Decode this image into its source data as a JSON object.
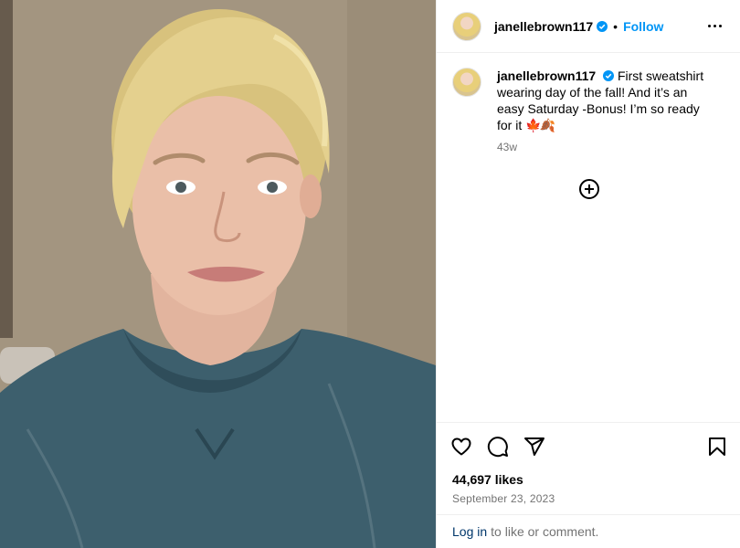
{
  "post": {
    "username": "janellebrown117",
    "follow_label": "Follow",
    "separator": "•",
    "caption_text": "First sweatshirt wearing day of the fall! And it’s an easy Saturday -Bonus! I’m so ready for it",
    "caption_emoji": "🍁🍂",
    "time_ago": "43w",
    "likes": "44,697 likes",
    "date": "September 23, 2023"
  },
  "login_bar": {
    "login_link": "Log in",
    "rest": "to like or comment."
  },
  "icons": {
    "verified": "verified-badge-icon",
    "more": "more-options-icon",
    "load_more": "plus-circle-icon",
    "like": "heart-icon",
    "comment": "comment-icon",
    "share": "send-icon",
    "save": "bookmark-icon"
  },
  "colors": {
    "accent": "#0095f6",
    "link": "#00376b",
    "secondary_text": "#737373",
    "border": "#efefef"
  }
}
